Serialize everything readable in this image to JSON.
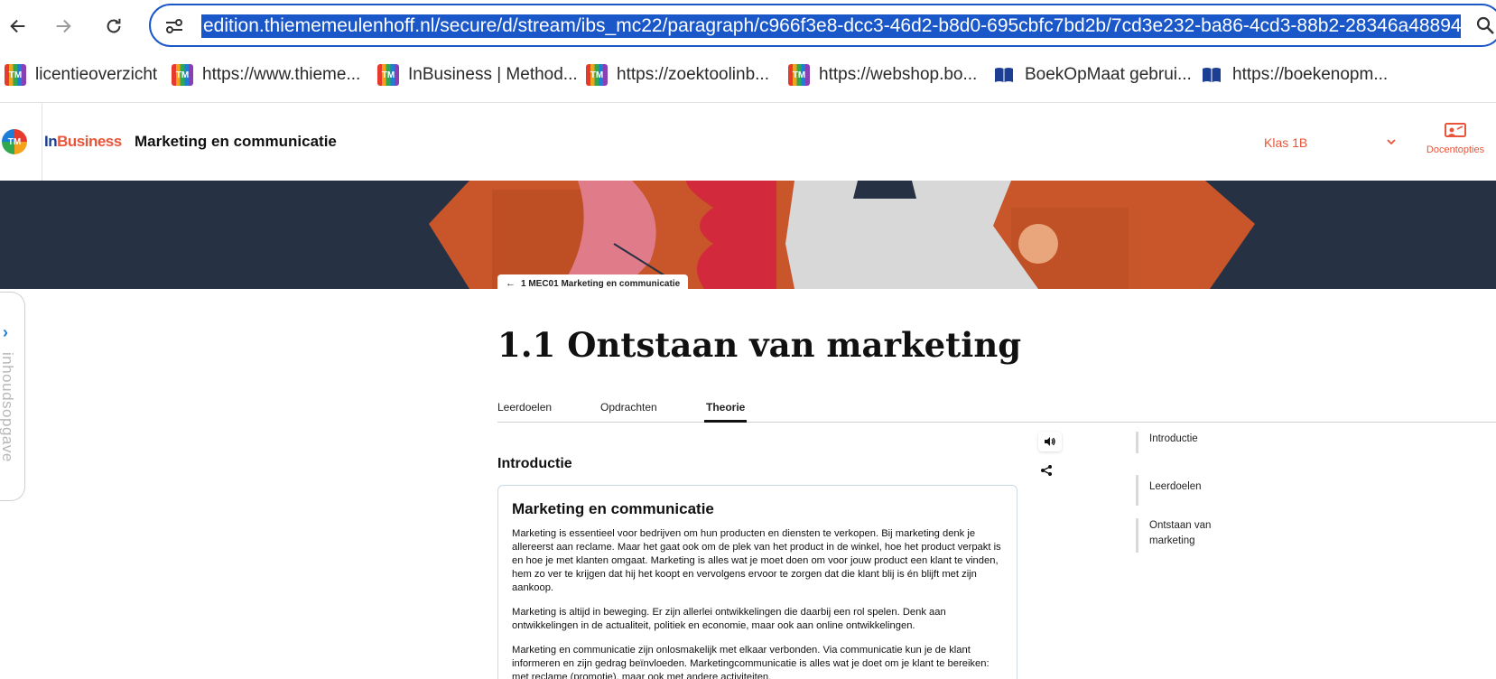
{
  "browser": {
    "url": "edition.thiememeulenhoff.nl/secure/d/stream/ibs_mc22/paragraph/c966f3e8-dcc3-46d2-b8d0-695cbfc7bd2b/7cd3e232-ba86-4cd3-88b2-28346a48894",
    "bookmarks": [
      {
        "label": "licentieoverzicht",
        "icon": "tm-icon"
      },
      {
        "label": "https://www.thieme...",
        "icon": "tm-icon"
      },
      {
        "label": "InBusiness | Method...",
        "icon": "tm-icon"
      },
      {
        "label": "https://zoektoolinb...",
        "icon": "tm-icon"
      },
      {
        "label": "https://webshop.bo...",
        "icon": "tm-icon"
      },
      {
        "label": "BoekOpMaat gebrui...",
        "icon": "book-icon"
      },
      {
        "label": "https://boekenopm...",
        "icon": "book-icon"
      }
    ]
  },
  "app": {
    "logo_text": "TM",
    "brand_in": "In",
    "brand_business": "Business",
    "course_title": "Marketing en communicatie",
    "klas": "Klas 1B",
    "docent_label": "Docentopties",
    "back_chip": "1 MEC01 Marketing en communicatie",
    "side_tab_label": "inhoudsopgave"
  },
  "main": {
    "title": "1.1 Ontstaan van marketing",
    "tabs": [
      {
        "label": "Leerdoelen",
        "active": false
      },
      {
        "label": "Opdrachten",
        "active": false
      },
      {
        "label": "Theorie",
        "active": true
      }
    ],
    "section_heading": "Introductie",
    "card": {
      "title": "Marketing en communicatie",
      "paragraphs": [
        "Marketing is essentieel voor bedrijven om hun producten en diensten te verkopen. Bij marketing denk je allereerst aan reclame. Maar het gaat ook om de plek van het product in de winkel, hoe het product verpakt is en hoe je met klanten omgaat. Marketing is alles wat je moet doen om voor jouw product een klant te vinden, hem zo ver te krijgen dat hij het koopt en vervolgens ervoor te zorgen dat die klant blij is én blijft met zijn aankoop.",
        "Marketing is altijd in beweging. Er zijn allerlei ontwikkelingen die daarbij een rol spelen. Denk aan ontwikkelingen in de actualiteit, politiek en economie, maar ook aan online ontwikkelingen.",
        "Marketing en communicatie zijn onlosmakelijk met elkaar verbonden. Via communicatie kun je de klant informeren en zijn gedrag beïnvloeden. Marketingcommunicatie is alles wat je doet om je klant te bereiken: met reclame (promotie), maar ook met andere activiteiten."
      ]
    },
    "toc": [
      {
        "label": "Introductie"
      },
      {
        "label": "Leerdoelen"
      },
      {
        "label": "Ontstaan van marketing"
      }
    ]
  },
  "colors": {
    "accent": "#e8553a",
    "brand_blue": "#1c3f94",
    "url_highlight": "#1a57c8",
    "banner_dark": "#263244",
    "banner_orange": "#c9562a"
  }
}
